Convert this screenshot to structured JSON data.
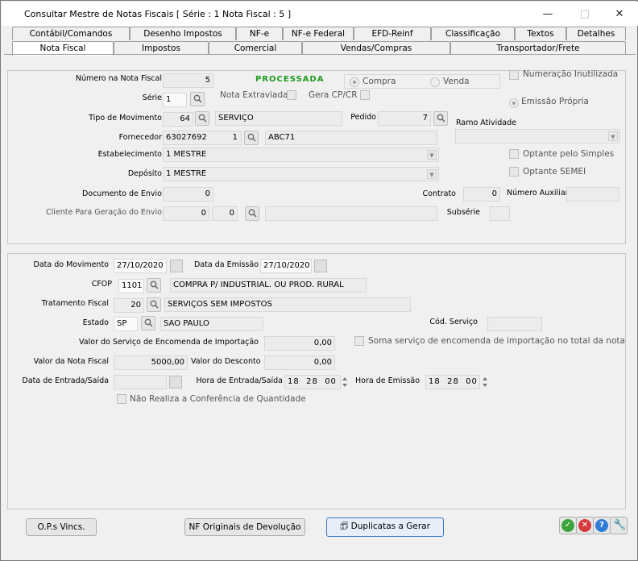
{
  "window": {
    "title": "Consultar Mestre de Notas Fiscais [ Série : 1   Nota Fiscal : 5 ]",
    "minimize": "—",
    "maximize": "□",
    "close": "✕"
  },
  "tabs_row1": [
    "Contábil/Comandos",
    "Desenho Impostos",
    "NF-e",
    "NF-e Federal",
    "EFD-Reinf",
    "Classificação",
    "Textos",
    "Detalhes"
  ],
  "tabs_row2": [
    "Nota Fiscal",
    "Impostos",
    "Comercial",
    "Vendas/Compras",
    "Transportador/Frete"
  ],
  "header": {
    "numero_label": "Número na Nota Fiscal",
    "numero": "5",
    "status": "PROCESSADA",
    "compra": "Compra",
    "venda": "Venda",
    "numeracao_inutilizada": "Numeração Inutilizada",
    "emissao_propria": "Emissão Própria",
    "serie_label": "Série",
    "serie": "1",
    "nota_extraviada": "Nota Extraviada",
    "gera_cpcr": "Gera CP/CR",
    "tipo_mov_label": "Tipo de Movimento",
    "tipo_mov_code": "64",
    "tipo_mov_desc": "SERVIÇO",
    "pedido_label": "Pedido",
    "pedido": "7",
    "ramo_label": "Ramo Atividade",
    "fornecedor_label": "Fornecedor",
    "fornecedor_code": "63027692",
    "fornecedor_seq": "1",
    "fornecedor_nome": "ABC71",
    "estab_label": "Estabelecimento",
    "estab": "1 MESTRE",
    "optante_simples": "Optante pelo Simples",
    "deposito_label": "Depósito",
    "deposito": "1 MESTRE",
    "optante_semei": "Optante SEMEI",
    "doc_envio_label": "Documento de Envio",
    "doc_envio": "0",
    "contrato_label": "Contrato",
    "contrato": "0",
    "num_aux_label": "Número Auxiliar",
    "cliente_label": "Cliente Para Geração do Envio",
    "cliente_code": "0",
    "cliente_seq": "0",
    "subserie_label": "Subsérie"
  },
  "detail": {
    "data_mov_label": "Data do Movimento",
    "data_mov": "27/10/2020",
    "data_emissao_label": "Data da Emissão",
    "data_emissao": "27/10/2020",
    "cfop_label": "CFOP",
    "cfop": "1101",
    "cfop_desc": "COMPRA P/ INDUSTRIAL. OU PROD. RURAL",
    "trat_label": "Tratamento Fiscal",
    "trat": "20",
    "trat_desc": "SERVIÇOS SEM IMPOSTOS",
    "estado_label": "Estado",
    "estado": "SP",
    "estado_desc": "SAO PAULO",
    "cod_servico_label": "Cód. Serviço",
    "valor_serv_label": "Valor do Serviço de Encomenda de Importação",
    "valor_serv": "0,00",
    "soma_servico": "Soma serviço de encomenda de importação no total da nota",
    "valor_nota_label": "Valor da Nota Fiscal",
    "valor_nota": "5000,00",
    "valor_desc_label": "Valor do Desconto",
    "valor_desc": "0,00",
    "data_es_label": "Data de Entrada/Saída",
    "hora_es_label": "Hora de Entrada/Saída",
    "hora_es": [
      "18",
      "28",
      "00"
    ],
    "hora_emissao_label": "Hora de Emissão",
    "hora_emissao": [
      "18",
      "28",
      "00"
    ],
    "nao_realiza": "Não Realiza a Conferência de Quantidade"
  },
  "footer": {
    "ops": "O.P.s Vincs.",
    "nf_originais": "NF Originais de  Devolução",
    "duplicatas": "Duplicatas a Gerar"
  },
  "colors": {
    "status_green": "#1f9a1f",
    "ok_green": "#3aa53a",
    "cancel_red": "#d63a3a",
    "help_blue": "#2e7bd6",
    "tool_orange": "#e08a1e"
  },
  "icons": [
    "app-icon",
    "search-icon",
    "calendar-icon",
    "spin-icon",
    "check-icon",
    "cancel-icon",
    "help-icon",
    "wrench-icon",
    "duplicate-icon"
  ]
}
